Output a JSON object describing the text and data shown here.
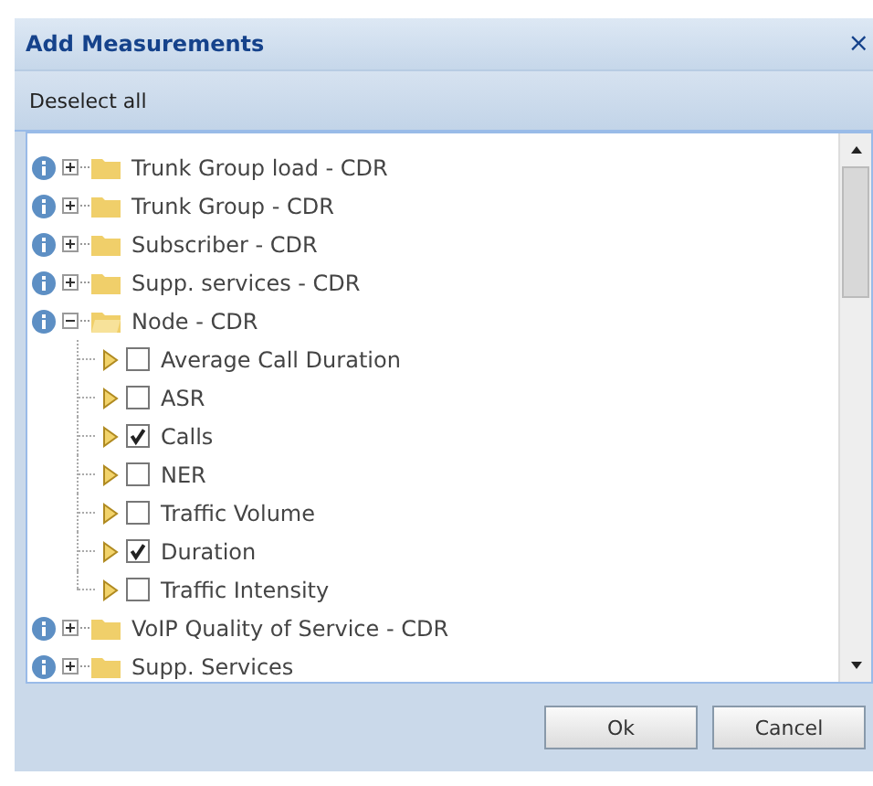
{
  "dialog": {
    "title": "Add Measurements",
    "close": "×"
  },
  "toolbar": {
    "button": "Deselect all"
  },
  "tree": [
    {
      "kind": "folder",
      "label": "Trunk Group load - CDR",
      "expanded": false
    },
    {
      "kind": "folder",
      "label": "Trunk Group - CDR",
      "expanded": false
    },
    {
      "kind": "folder",
      "label": "Subscriber - CDR",
      "expanded": false
    },
    {
      "kind": "folder",
      "label": "Supp. services - CDR",
      "expanded": false
    },
    {
      "kind": "folder",
      "label": "Node - CDR",
      "expanded": true,
      "children": [
        {
          "kind": "measure",
          "label": "Average Call Duration",
          "checked": false
        },
        {
          "kind": "measure",
          "label": "ASR",
          "checked": false
        },
        {
          "kind": "measure",
          "label": "Calls",
          "checked": true
        },
        {
          "kind": "measure",
          "label": "NER",
          "checked": false
        },
        {
          "kind": "measure",
          "label": "Traffic Volume",
          "checked": false
        },
        {
          "kind": "measure",
          "label": "Duration",
          "checked": true
        },
        {
          "kind": "measure",
          "label": "Traffic Intensity",
          "checked": false
        }
      ]
    },
    {
      "kind": "folder",
      "label": "VoIP Quality of Service - CDR",
      "expanded": false
    },
    {
      "kind": "folder",
      "label": "Supp. Services",
      "expanded": false
    }
  ],
  "buttons": [
    "Ok",
    "Cancel"
  ]
}
